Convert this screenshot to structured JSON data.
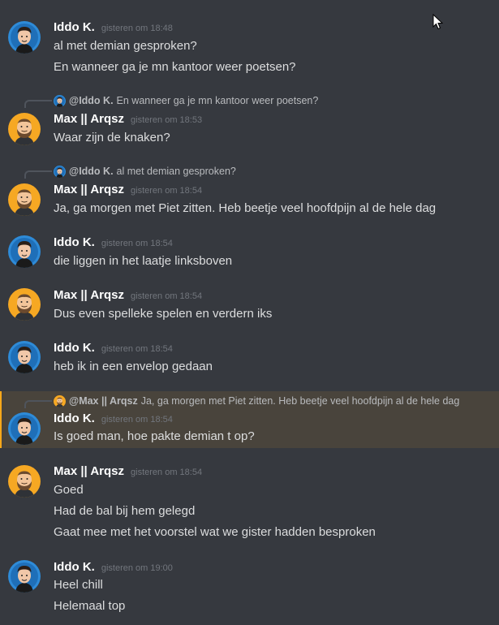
{
  "users": {
    "iddo": {
      "name": "Iddo K.",
      "mention": "@Iddo K."
    },
    "max": {
      "name": "Max || Arqsz",
      "mention": "@Max || Arqsz"
    }
  },
  "messages": [
    {
      "author": "Iddo K.",
      "timestamp": "gisteren om 18:48",
      "lines": [
        "al met demian gesproken?",
        "En wanneer ga je mn kantoor weer poetsen?"
      ]
    },
    {
      "reply": {
        "mention": "@Iddo K.",
        "text": "En wanneer ga je mn kantoor weer poetsen?"
      },
      "author": "Max || Arqsz",
      "timestamp": "gisteren om 18:53",
      "lines": [
        "Waar zijn de knaken?"
      ]
    },
    {
      "reply": {
        "mention": "@Iddo K.",
        "text": "al met demian gesproken?"
      },
      "author": "Max || Arqsz",
      "timestamp": "gisteren om 18:54",
      "lines": [
        "Ja, ga morgen met Piet zitten. Heb beetje veel hoofdpijn al de hele dag"
      ]
    },
    {
      "author": "Iddo K.",
      "timestamp": "gisteren om 18:54",
      "lines": [
        "die liggen in het laatje linksboven"
      ]
    },
    {
      "author": "Max || Arqsz",
      "timestamp": "gisteren om 18:54",
      "lines": [
        "Dus even spelleke spelen en verdern iks"
      ]
    },
    {
      "author": "Iddo K.",
      "timestamp": "gisteren om 18:54",
      "lines": [
        "heb ik in een envelop gedaan"
      ]
    },
    {
      "reply": {
        "mention": "@Max || Arqsz",
        "text": "Ja, ga morgen met Piet zitten. Heb beetje veel hoofdpijn al de hele dag"
      },
      "author": "Iddo K.",
      "timestamp": "gisteren om 18:54",
      "lines": [
        "Is goed man, hoe pakte demian t op?"
      ],
      "highlighted": true
    },
    {
      "author": "Max || Arqsz",
      "timestamp": "gisteren om 18:54",
      "lines": [
        "Goed",
        "Had de bal bij hem gelegd",
        "Gaat mee met het voorstel wat we gister hadden besproken"
      ]
    },
    {
      "author": "Iddo K.",
      "timestamp": "gisteren om 19:00",
      "lines": [
        "Heel chill",
        "Helemaal top"
      ]
    }
  ],
  "colors": {
    "background": "#36393f",
    "highlight": "#49443c",
    "highlight_bar": "#faa81a",
    "username": "#ffffff",
    "text": "#dcddde",
    "timestamp": "#72767d"
  },
  "icons": {
    "iddo_avatar": "iddo-avatar-icon",
    "max_avatar": "max-avatar-icon",
    "cursor": "mouse-cursor-icon"
  }
}
